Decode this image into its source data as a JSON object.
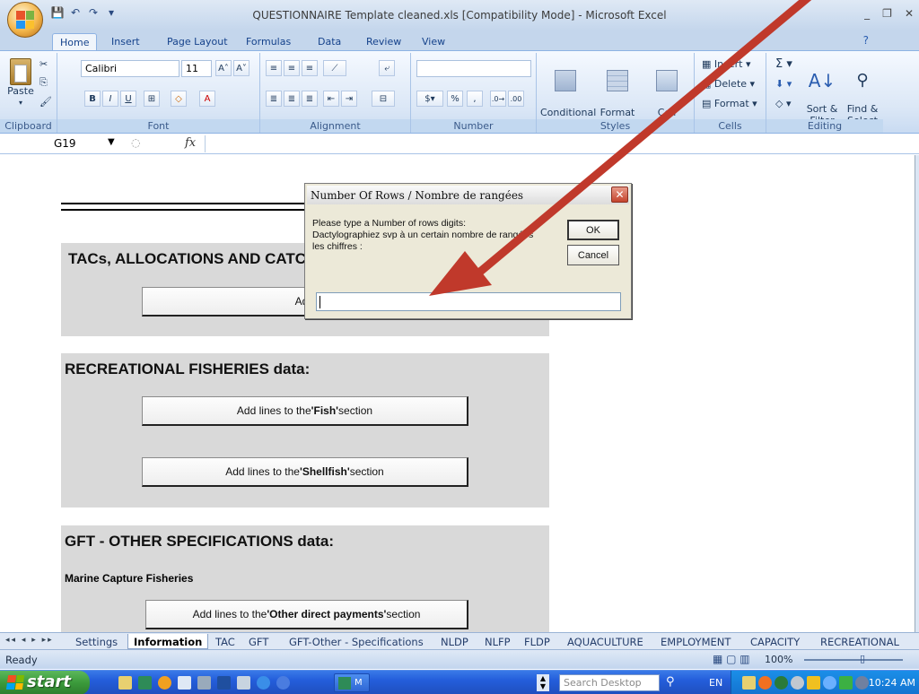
{
  "window": {
    "title": "QUESTIONNAIRE Template cleaned.xls  [Compatibility Mode] - Microsoft Excel",
    "min": "_",
    "restore": "❐",
    "close": "✕"
  },
  "ribbon_tabs": [
    "Home",
    "Insert",
    "Page Layout",
    "Formulas",
    "Data",
    "Review",
    "View"
  ],
  "ribbon": {
    "clipboard": {
      "label": "Clipboard",
      "paste": "Paste"
    },
    "font": {
      "label": "Font",
      "name": "Calibri",
      "size": "11"
    },
    "alignment": {
      "label": "Alignment"
    },
    "number": {
      "label": "Number",
      "percent": "%",
      "comma": ","
    },
    "styles": {
      "label": "Styles",
      "conditional": "Conditional\nFormatting",
      "format_table": "Format\nas Table",
      "cell_styles": "Cell\nStyles"
    },
    "cells": {
      "label": "Cells",
      "insert": "Insert",
      "delete": "Delete",
      "format": "Format"
    },
    "editing": {
      "label": "Editing",
      "sort": "Sort &\nFilter",
      "find": "Find &\nSelect"
    }
  },
  "formula_bar": {
    "name_box": "G19",
    "fx": "fx",
    "value": ""
  },
  "sheet": {
    "section1_title": "TACs, ALLOCATIONS AND CATC",
    "section1_button": "Add lines to t",
    "section2_title": "RECREATIONAL FISHERIES data:",
    "section2_button1_prefix": "Add lines to the ",
    "section2_button1_bold": "'Fish'",
    "section2_button1_suffix": " section",
    "section2_button2_prefix": "Add lines to the ",
    "section2_button2_bold": "'Shellfish'",
    "section2_button2_suffix": " section",
    "section3_title": "GFT - OTHER SPECIFICATIONS data:",
    "section3_sub": "Marine Capture Fisheries",
    "section3_button_prefix": "Add lines to the ",
    "section3_button_bold": "'Other direct payments'",
    "section3_button_suffix": " section"
  },
  "dialog": {
    "title": "Number Of Rows / Nombre de rangées",
    "prompt": "Please type a Number of rows digits:\nDactylographiez svp à un certain nombre de rangées\nles chiffres :",
    "ok": "OK",
    "cancel": "Cancel",
    "input_value": ""
  },
  "sheet_tabs": [
    "Settings",
    "Information",
    "TAC",
    "GFT",
    "GFT-Other - Specifications",
    "NLDP",
    "NLFP",
    "FLDP",
    "AQUACULTURE",
    "EMPLOYMENT",
    "CAPACITY",
    "RECREATIONAL"
  ],
  "active_sheet": "Information",
  "status": {
    "text": "Ready",
    "zoom": "100%"
  },
  "taskbar": {
    "start": "start",
    "search_placeholder": "Search Desktop",
    "lang": "EN",
    "clock": "10:24 AM",
    "task_label": "M"
  },
  "colors": {
    "accent": "#15428b",
    "arrow": "#c0392b",
    "panel": "#d9d9d9"
  }
}
